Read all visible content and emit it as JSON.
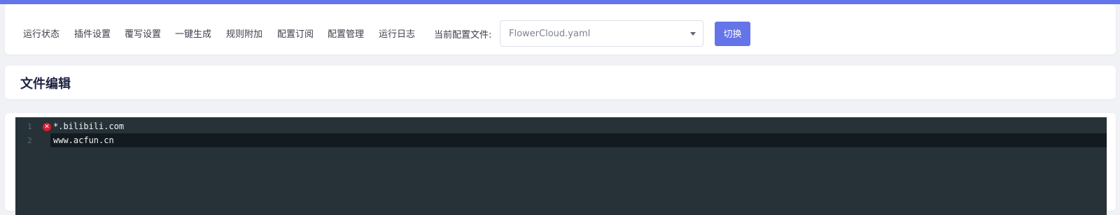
{
  "nav": {
    "items": [
      {
        "label": "运行状态"
      },
      {
        "label": "插件设置"
      },
      {
        "label": "覆写设置"
      },
      {
        "label": "一键生成"
      },
      {
        "label": "规则附加"
      },
      {
        "label": "配置订阅"
      },
      {
        "label": "配置管理"
      },
      {
        "label": "运行日志"
      }
    ],
    "config_label": "当前配置文件:",
    "config_select_value": "FlowerCloud.yaml",
    "switch_label": "切换"
  },
  "page": {
    "title": "文件编辑"
  },
  "editor": {
    "lines": [
      {
        "number": "1",
        "text": "*.bilibili.com",
        "error": true
      },
      {
        "number": "2",
        "text": "www.acfun.cn",
        "error": false
      }
    ],
    "error_icon": "error-x-icon"
  },
  "colors": {
    "accent": "#6574e8",
    "editor_bg": "#263238",
    "error": "#d81e2b"
  }
}
